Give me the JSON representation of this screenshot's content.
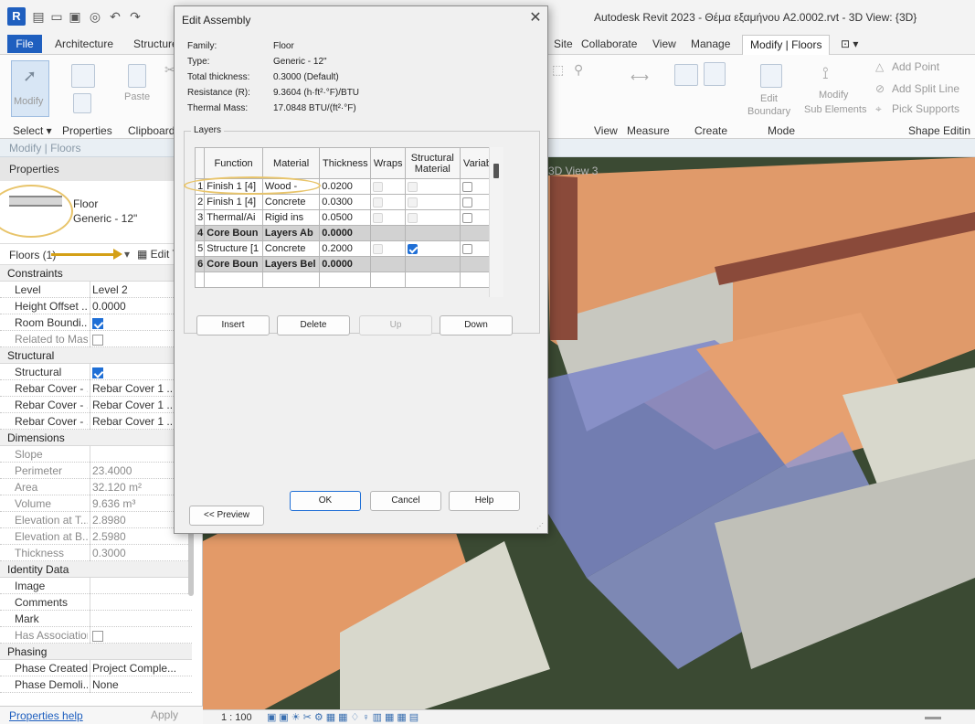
{
  "window": {
    "title": "Autodesk Revit 2023 - Θέμα εξαμήνου A2.0002.rvt - 3D View: {3D}",
    "logo": "R",
    "quick_access_icons": [
      "open-icon",
      "save-icon",
      "sync-icon",
      "undo-icon",
      "redo-icon"
    ]
  },
  "ribbon": {
    "tabs": [
      "File",
      "Architecture",
      "Structure",
      "Site",
      "Collaborate",
      "View",
      "Manage",
      "Modify | Floors"
    ],
    "active_tab": "Modify | Floors",
    "extra_tab_glyph": "⊡ ▾",
    "buttons": {
      "modify": "Modify",
      "paste": "Paste",
      "edit_boundary_1": "Edit",
      "edit_boundary_2": "Boundary",
      "modify_sub_1": "Modify",
      "modify_sub_2": "Sub Elements",
      "add_point": "Add Point",
      "add_split_line": "Add Split Line",
      "pick_supports": "Pick Supports"
    },
    "groups": {
      "select": "Select ▾",
      "properties": "Properties",
      "clipboard": "Clipboard",
      "view": "View",
      "measure": "Measure",
      "create": "Create",
      "mode": "Mode",
      "shape_editing": "Shape Editin"
    }
  },
  "context_bar": {
    "label": "Modify | Floors"
  },
  "properties": {
    "header": "Properties",
    "type_family": "Floor",
    "type_name": "Generic - 12\"",
    "instance_selector": "Floors (1)",
    "instance_selector_arrow": "▾",
    "edit_type": "Edit T",
    "sections": [
      {
        "title": "Constraints",
        "rows": [
          {
            "k": "Level",
            "v": "Level 2",
            "dim": false
          },
          {
            "k": "Height Offset ...",
            "v": "0.0000",
            "dim": false
          },
          {
            "k": "Room Boundi...",
            "cb": "on",
            "dim": false
          },
          {
            "k": "Related to Mass",
            "cb": "off",
            "dim": true
          }
        ]
      },
      {
        "title": "Structural",
        "rows": [
          {
            "k": "Structural",
            "cb": "on",
            "dim": false
          },
          {
            "k": "Rebar Cover - ...",
            "v": "Rebar Cover 1 ...",
            "dim": false
          },
          {
            "k": "Rebar Cover - ...",
            "v": "Rebar Cover 1 ...",
            "dim": false
          },
          {
            "k": "Rebar Cover - ...",
            "v": "Rebar Cover 1 ...",
            "dim": false
          }
        ]
      },
      {
        "title": "Dimensions",
        "rows": [
          {
            "k": "Slope",
            "v": "",
            "dim": true
          },
          {
            "k": "Perimeter",
            "v": "23.4000",
            "dim": true
          },
          {
            "k": "Area",
            "v": "32.120 m²",
            "dim": true
          },
          {
            "k": "Volume",
            "v": "9.636 m³",
            "dim": true
          },
          {
            "k": "Elevation at T...",
            "v": "2.8980",
            "dim": true
          },
          {
            "k": "Elevation at B...",
            "v": "2.5980",
            "dim": true
          },
          {
            "k": "Thickness",
            "v": "0.3000",
            "dim": true
          }
        ]
      },
      {
        "title": "Identity Data",
        "rows": [
          {
            "k": "Image",
            "v": "",
            "dim": false
          },
          {
            "k": "Comments",
            "v": "",
            "dim": false
          },
          {
            "k": "Mark",
            "v": "",
            "dim": false
          },
          {
            "k": "Has Association",
            "cb": "off",
            "dim": true
          }
        ]
      },
      {
        "title": "Phasing",
        "rows": [
          {
            "k": "Phase Created",
            "v": "Project Comple...",
            "dim": false
          },
          {
            "k": "Phase Demoli...",
            "v": "None",
            "dim": false
          }
        ]
      }
    ],
    "help_link": "Properties help",
    "apply": "Apply"
  },
  "view": {
    "tab_label": "3D View 3",
    "scale": "1 : 100"
  },
  "dialog": {
    "title": "Edit Assembly",
    "close": "✕",
    "info": [
      {
        "k": "Family:",
        "v": "Floor"
      },
      {
        "k": "Type:",
        "v": "Generic - 12\""
      },
      {
        "k": "Total thickness:",
        "v": "0.3000 (Default)"
      },
      {
        "k": "Resistance (R):",
        "v": "9.3604 (h·ft²·°F)/BTU"
      },
      {
        "k": "Thermal Mass:",
        "v": "17.0848 BTU/(ft²·°F)"
      }
    ],
    "layers_label": "Layers",
    "columns": [
      "Function",
      "Material",
      "Thickness",
      "Wraps",
      "Structural Material",
      "Variable"
    ],
    "rows": [
      {
        "n": "1",
        "function": "Finish 1 [4]",
        "material": "Wood -",
        "thickness": "0.0200",
        "wraps": "dis",
        "structural": "dis",
        "variable": "off",
        "core": false
      },
      {
        "n": "2",
        "function": "Finish 1 [4]",
        "material": "Concrete",
        "thickness": "0.0300",
        "wraps": "dis",
        "structural": "dis",
        "variable": "off",
        "core": false
      },
      {
        "n": "3",
        "function": "Thermal/Ai",
        "material": "Rigid ins",
        "thickness": "0.0500",
        "wraps": "dis",
        "structural": "dis",
        "variable": "off",
        "core": false
      },
      {
        "n": "4",
        "function": "Core Boun",
        "material": "Layers Ab",
        "thickness": "0.0000",
        "core": true
      },
      {
        "n": "5",
        "function": "Structure [1",
        "material": "Concrete",
        "thickness": "0.2000",
        "wraps": "dis",
        "structural": "on",
        "variable": "off",
        "core": false
      },
      {
        "n": "6",
        "function": "Core Boun",
        "material": "Layers Bel",
        "thickness": "0.0000",
        "core": true
      }
    ],
    "buttons": {
      "insert": "Insert",
      "delete": "Delete",
      "up": "Up",
      "down": "Down",
      "ok": "OK",
      "cancel": "Cancel",
      "help": "Help",
      "preview": "<< Preview"
    }
  }
}
